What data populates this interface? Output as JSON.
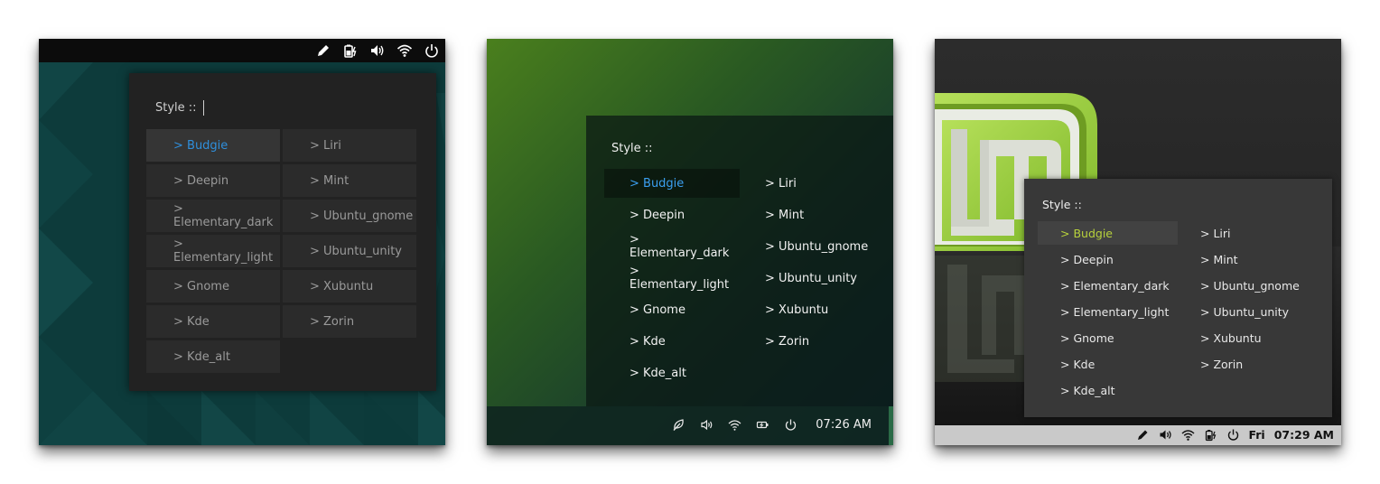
{
  "colors": {
    "shot1_accent": "#2f8fdc",
    "shot2_accent": "#3b9ff0",
    "shot3_accent": "#b8d23c"
  },
  "screens": [
    {
      "style_label": "Style ::",
      "selected": "> Budgie",
      "tray_icons": [
        "pencil-icon",
        "battery-charging-icon",
        "volume-icon",
        "wifi-icon",
        "power-icon"
      ],
      "items": [
        "> Budgie",
        "> Liri",
        "> Deepin",
        "> Mint",
        "> Elementary_dark",
        "> Ubuntu_gnome",
        "> Elementary_light",
        "> Ubuntu_unity",
        "> Gnome",
        "> Xubuntu",
        "> Kde",
        "> Zorin",
        "> Kde_alt"
      ]
    },
    {
      "style_label": "Style ::",
      "selected": "> Budgie",
      "tray_icons": [
        "leaf-icon",
        "volume-icon",
        "wifi-icon",
        "battery-icon",
        "power-icon"
      ],
      "clock": "07:26 AM",
      "items": [
        "> Budgie",
        "> Liri",
        "> Deepin",
        "> Mint",
        "> Elementary_dark",
        "> Ubuntu_gnome",
        "> Elementary_light",
        "> Ubuntu_unity",
        "> Gnome",
        "> Xubuntu",
        "> Kde",
        "> Zorin",
        "> Kde_alt"
      ]
    },
    {
      "style_label": "Style ::",
      "selected": "> Budgie",
      "tray_icons": [
        "pencil-icon",
        "volume-icon",
        "wifi-icon",
        "battery-charging-icon",
        "power-icon"
      ],
      "day": "Fri",
      "clock": "07:29 AM",
      "items": [
        "> Budgie",
        "> Liri",
        "> Deepin",
        "> Mint",
        "> Elementary_dark",
        "> Ubuntu_gnome",
        "> Elementary_light",
        "> Ubuntu_unity",
        "> Gnome",
        "> Xubuntu",
        "> Kde",
        "> Zorin",
        "> Kde_alt"
      ]
    }
  ]
}
